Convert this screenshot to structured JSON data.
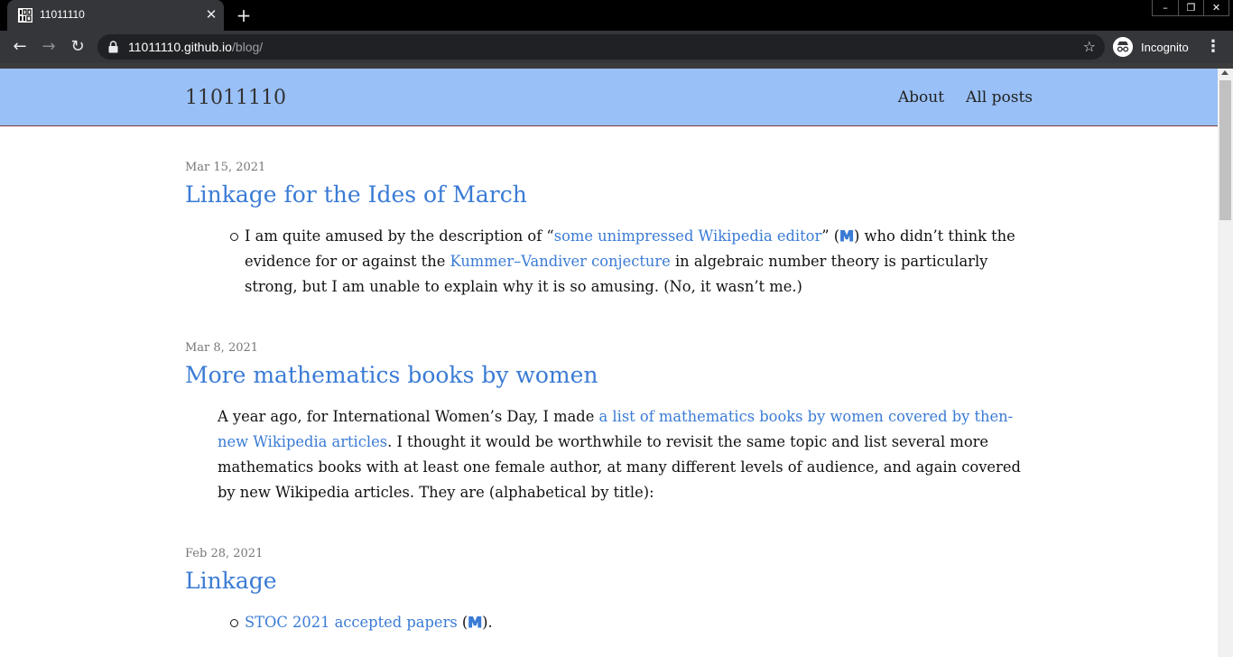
{
  "browser": {
    "tab_title": "11011110",
    "tab_close_glyph": "✕",
    "new_tab_glyph": "+",
    "window_controls": [
      "–",
      "❐",
      "✕"
    ],
    "back_glyph": "←",
    "forward_glyph": "→",
    "reload_glyph": "↻",
    "url_host": "11011110.github.io",
    "url_path": "/blog/",
    "bookmark_glyph": "☆",
    "incognito_label": "Incognito",
    "menu_glyph": "⋮"
  },
  "site": {
    "title": "11011110",
    "nav": [
      {
        "label": "About"
      },
      {
        "label": "All posts"
      }
    ]
  },
  "posts": [
    {
      "date": "Mar 15, 2021",
      "title": "Linkage for the Ides of March",
      "item": {
        "t1": "I am quite amused by the description of “",
        "link1": "some unimpressed Wikipedia editor",
        "t2": "” (",
        "mast": "M",
        "t3": ") who didn’t think the evidence for or against the ",
        "link2": "Kummer–Vandiver conjecture",
        "t4": " in algebraic number theory is particularly strong, but I am unable to explain why it is so amusing. (No, it wasn’t me.)"
      }
    },
    {
      "date": "Mar 8, 2021",
      "title": "More mathematics books by women",
      "para": {
        "t1": "A year ago, for International Women’s Day, I made ",
        "link1": "a list of mathematics books by women covered by then-new Wikipedia articles",
        "t2": ". I thought it would be worthwhile to revisit the same topic and list several more mathematics books with at least one female author, at many different levels of audience, and again covered by new Wikipedia articles. They are (alphabetical by title):"
      }
    },
    {
      "date": "Feb 28, 2021",
      "title": "Linkage",
      "item": {
        "link1": "STOC 2021 accepted papers",
        "t2": " (",
        "mast": "M",
        "t3": ")."
      }
    }
  ]
}
